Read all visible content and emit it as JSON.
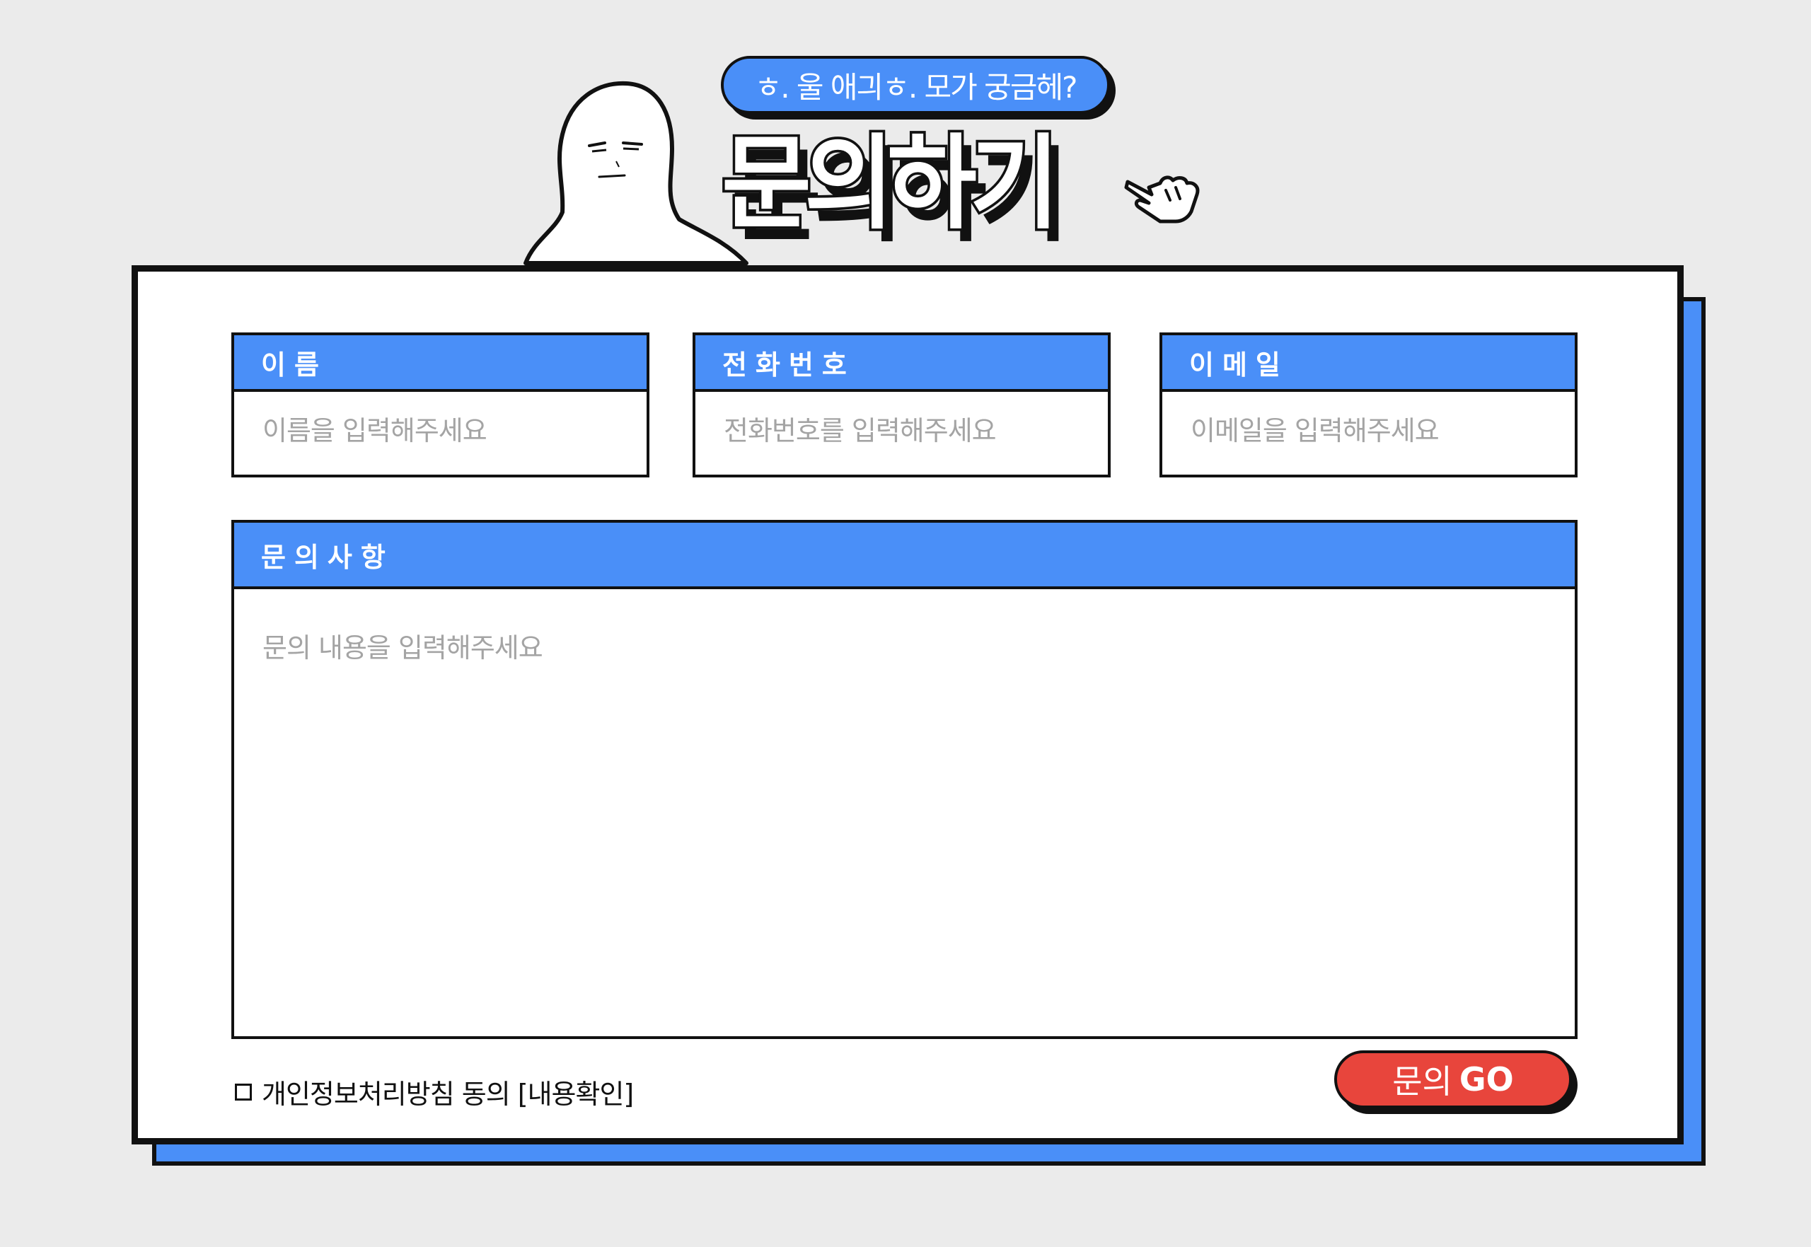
{
  "header": {
    "tagline": "ㅎ. 울 애긔ㅎ. 모가 궁금헤?",
    "title": "문의하기"
  },
  "form": {
    "name": {
      "label": "이름",
      "placeholder": "이름을 입력해주세요"
    },
    "phone": {
      "label": "전화번호",
      "placeholder": "전화번호를 입력해주세요"
    },
    "email": {
      "label": "이메일",
      "placeholder": "이메일을 입력해주세요"
    },
    "message": {
      "label": "문의사항",
      "placeholder": "문의 내용을 입력해주세요"
    },
    "agree_label": "개인정보처리방침 동의 [내용확인]",
    "submit": {
      "prefix": "문의",
      "suffix": "GO"
    }
  },
  "colors": {
    "background": "#ebebeb",
    "accent_blue": "#4a8ff8",
    "submit_red": "#e8453c",
    "outline": "#111111"
  },
  "icons": [
    "ghost-character-illustration",
    "pointing-hand-icon",
    "checkbox-icon"
  ]
}
